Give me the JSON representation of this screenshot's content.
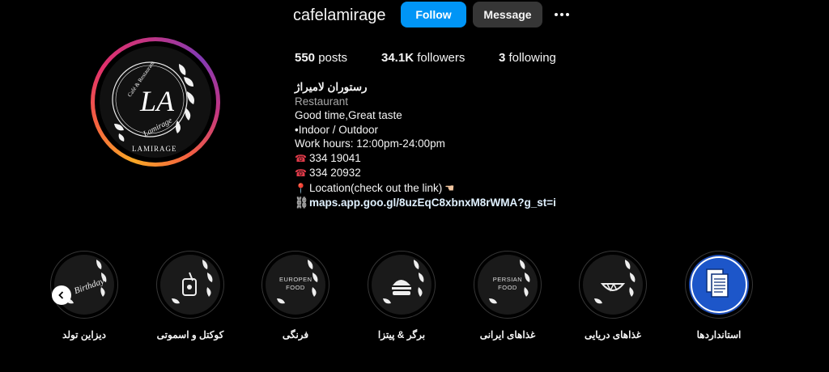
{
  "profile": {
    "username": "cafelamirage",
    "follow_label": "Follow",
    "message_label": "Message",
    "avatar_text": {
      "monogram": "LA",
      "arc": "Café & Restaurant",
      "script": "Lamirage",
      "name": "LAMIRAGE"
    }
  },
  "stats": {
    "posts_count": "550",
    "posts_label": "posts",
    "followers_count": "34.1K",
    "followers_label": "followers",
    "following_count": "3",
    "following_label": "following"
  },
  "bio": {
    "full_name": "رستوران لامیراژ",
    "category": "Restaurant",
    "line1": "Good time,Great taste",
    "line2": "•Indoor / Outdoor",
    "line3": "Work hours: 12:00pm-24:00pm",
    "phone1": "334 19041",
    "phone2": "334 20932",
    "location": "Location(check out the link)",
    "link": "maps.app.goo.gl/8uzEqC8xbnxM8rWMA?g_st=i"
  },
  "highlights": [
    {
      "label": "دیزاین تولد",
      "icon": "birthday-icon",
      "text": "Birthday"
    },
    {
      "label": "کوکتل و اسموتی",
      "icon": "cocktail-icon",
      "text": ""
    },
    {
      "label": "فرنگی",
      "icon": "europen-food-icon",
      "text": "EUROPEN FOOD"
    },
    {
      "label": "برگر & پیتزا",
      "icon": "burger-icon",
      "text": ""
    },
    {
      "label": "غذاهای ایرانی",
      "icon": "persian-food-icon",
      "text": "PERSIAN FOOD"
    },
    {
      "label": "غذاهای دریایی",
      "icon": "seafood-icon",
      "text": ""
    },
    {
      "label": "استانداردها",
      "icon": "documents-icon",
      "text": ""
    }
  ],
  "colors": {
    "background": "#000000",
    "follow_button": "#0095f6",
    "message_button": "#363636",
    "link": "#e0f1ff",
    "muted": "#a8a8a8"
  }
}
